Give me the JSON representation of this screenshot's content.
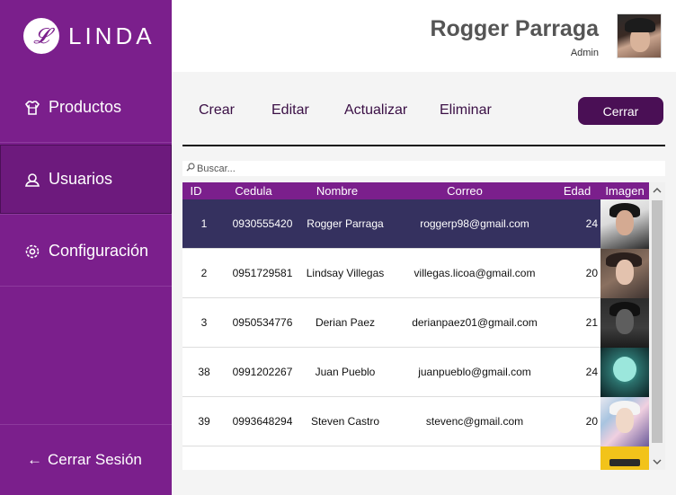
{
  "app": {
    "logo_letter": "𝓛",
    "logo_text": "LINDA"
  },
  "sidebar": {
    "items": [
      {
        "label": "Productos",
        "icon": "shirt-icon"
      },
      {
        "label": "Usuarios",
        "icon": "user-icon"
      },
      {
        "label": "Configuración",
        "icon": "gear-icon"
      }
    ],
    "logout": {
      "arrow": "←",
      "label": "Cerrar Sesión"
    }
  },
  "header": {
    "user_name": "Rogger Parraga",
    "user_role": "Admin"
  },
  "toolbar": {
    "crear": "Crear",
    "editar": "Editar",
    "actualizar": "Actualizar",
    "eliminar": "Eliminar",
    "cerrar": "Cerrar"
  },
  "search": {
    "placeholder": "Buscar..."
  },
  "table": {
    "headers": [
      "ID",
      "Cedula",
      "Nombre",
      "Correo",
      "Edad",
      "Imagen"
    ],
    "rows": [
      {
        "id": "1",
        "cedula": "0930555420",
        "nombre": "Rogger Parraga",
        "correo": "roggerp98@gmail.com",
        "edad": "24",
        "selected": true
      },
      {
        "id": "2",
        "cedula": "0951729581",
        "nombre": "Lindsay Villegas",
        "correo": "villegas.licoa@gmail.com",
        "edad": "20",
        "selected": false
      },
      {
        "id": "3",
        "cedula": "0950534776",
        "nombre": "Derian Paez",
        "correo": "derianpaez01@gmail.com",
        "edad": "21",
        "selected": false
      },
      {
        "id": "38",
        "cedula": "0991202267",
        "nombre": "Juan Pueblo",
        "correo": "juanpueblo@gmail.com",
        "edad": "24",
        "selected": false
      },
      {
        "id": "39",
        "cedula": "0993648294",
        "nombre": "Steven Castro",
        "correo": "stevenc@gmail.com",
        "edad": "20",
        "selected": false
      }
    ]
  },
  "colors": {
    "sidebar": "#7b1f8c",
    "selected_row": "#35315f",
    "button": "#4a0f55"
  }
}
